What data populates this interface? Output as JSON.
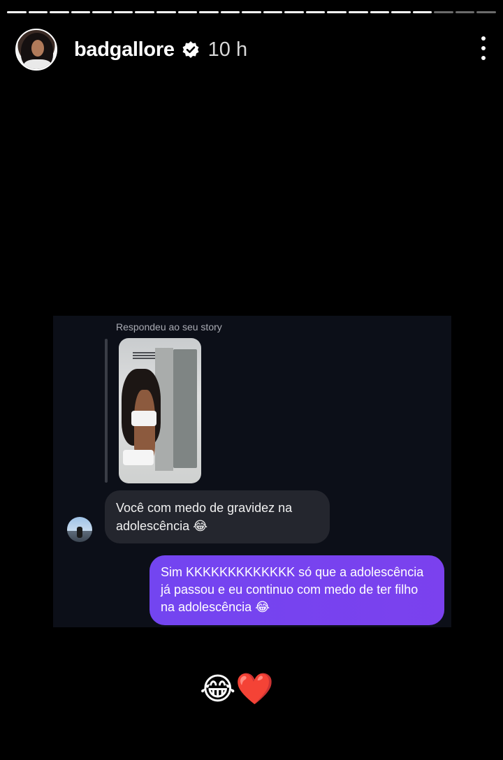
{
  "story": {
    "username": "badgallore",
    "time": "10 h",
    "verified_icon": "verified-badge-icon",
    "more_icon": "more-vertical-icon",
    "segments_total": 23,
    "segments_viewed": 20
  },
  "dm_screenshot": {
    "replied_label": "Respondeu ao seu story",
    "incoming_message": "Você com medo de gravidez na adolescência 😂",
    "outgoing_message": "Sim KKKKKKKKKKKKK só que a adolescência já passou e eu continuo com medo de ter filho na adolescência 😂"
  },
  "stickers": {
    "emoji_text": "😂❤️"
  },
  "colors": {
    "background": "#000000",
    "panel": "#0c0f18",
    "incoming_bubble": "#24262e",
    "outgoing_bubble": "#7345f0"
  }
}
